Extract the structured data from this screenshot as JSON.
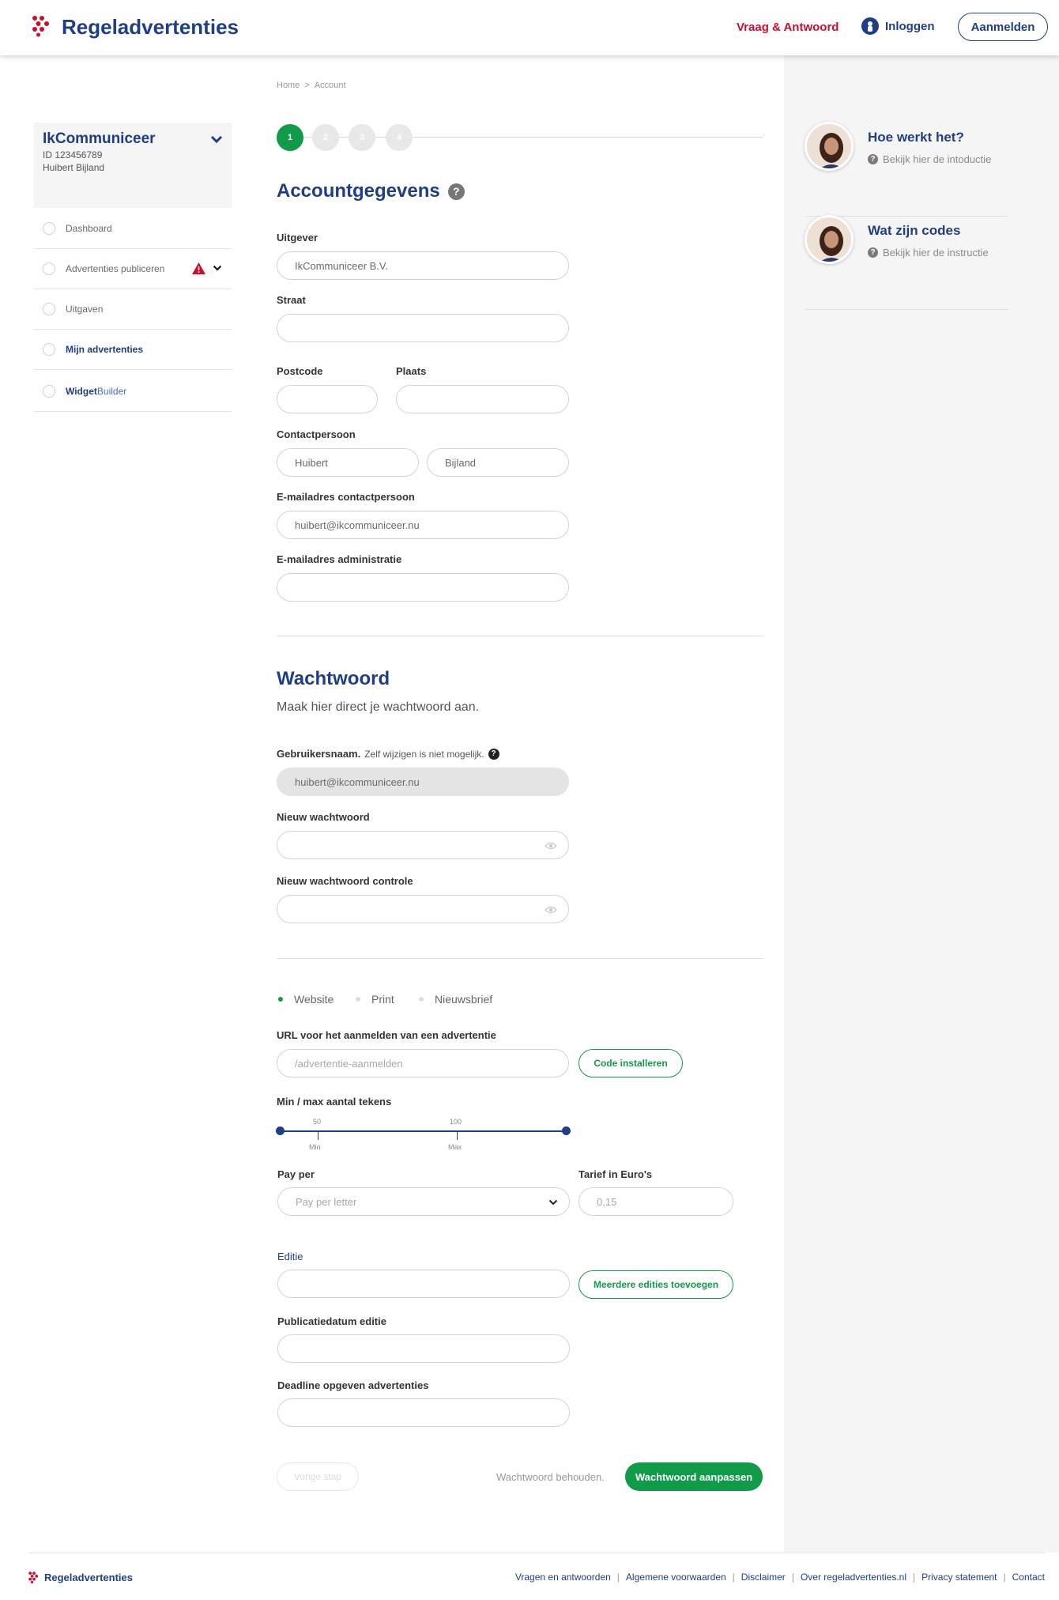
{
  "header": {
    "brand": "Regeladvertenties",
    "faq_link": "Vraag & Antwoord",
    "login_link": "Inloggen",
    "signup_button": "Aanmelden"
  },
  "breadcrumb": {
    "home": "Home",
    "separator": ">",
    "current": "Account"
  },
  "sidebar": {
    "account_name": "IkCommuniceer",
    "account_id": "ID 123456789",
    "account_user": "Huibert Bijland",
    "items": [
      {
        "label": "Dashboard"
      },
      {
        "label": "Advertenties publiceren"
      },
      {
        "label": "Uitgaven"
      },
      {
        "label": "Mijn advertenties"
      },
      {
        "label_bold": "Widget",
        "label_rest": "Builder"
      }
    ]
  },
  "steps": [
    "1",
    "2",
    "3",
    "4"
  ],
  "account_section": {
    "title": "Accountgegevens",
    "publisher_label": "Uitgever",
    "publisher_value": "IkCommuniceer B.V.",
    "street_label": "Straat",
    "street_value": "",
    "postcode_label": "Postcode",
    "postcode_value": "",
    "city_label": "Plaats",
    "city_value": "",
    "contact_label": "Contactpersoon",
    "contact_first": "Huibert",
    "contact_last": "Bijland",
    "contact_email_label": "E-mailadres contactpersoon",
    "contact_email_value": "huibert@ikcommuniceer.nu",
    "admin_email_label": "E-mailadres administratie",
    "admin_email_value": ""
  },
  "password_section": {
    "title": "Wachtwoord",
    "subtitle": "Maak hier direct je wachtwoord aan.",
    "username_label": "Gebruikersnaam.",
    "username_note": "Zelf wijzigen is niet mogelijk.",
    "username_value": "huibert@ikcommuniceer.nu",
    "new_password_label": "Nieuw wachtwoord",
    "confirm_password_label": "Nieuw wachtwoord controle"
  },
  "channel_options": [
    {
      "label": "Website",
      "selected": true
    },
    {
      "label": "Print",
      "selected": false
    },
    {
      "label": "Nieuwsbrief",
      "selected": false
    }
  ],
  "url_section": {
    "label": "URL voor het aanmelden van een advertentie",
    "placeholder": "/advertentie-aanmelden",
    "install_button": "Code installeren"
  },
  "chars_section": {
    "label": "Min / max aantal tekens",
    "min_value": "50",
    "max_value": "100",
    "min_label": "Min",
    "max_label": "Max"
  },
  "pricing": {
    "pay_per_label": "Pay per",
    "pay_per_value": "Pay per letter",
    "rate_label": "Tarief in Euro's",
    "rate_placeholder": "0,15"
  },
  "edition": {
    "label": "Editie",
    "add_button": "Meerdere edities toevoegen",
    "pubdate_label": "Publicatiedatum editie",
    "deadline_label": "Deadline opgeven advertenties"
  },
  "actions": {
    "prev_step": "Vorige stap",
    "keep_password": "Wachtwoord behouden.",
    "change_password": "Wachtwoord aanpassen"
  },
  "help": [
    {
      "title": "Hoe werkt het?",
      "sub": "Bekijk hier de intoductie"
    },
    {
      "title": "Wat zijn codes",
      "sub": "Bekijk hier de instructie"
    }
  ],
  "footer": {
    "brand": "Regeladvertenties",
    "links": [
      "Vragen en antwoorden",
      "Algemene voorwaarden",
      "Disclaimer",
      "Over regeladvertenties.nl",
      "Privacy statement",
      "Contact"
    ],
    "separator": "|"
  },
  "colors": {
    "brand_blue": "#1e3f85",
    "accent_red": "#c8102e",
    "green": "#0f9b48"
  }
}
